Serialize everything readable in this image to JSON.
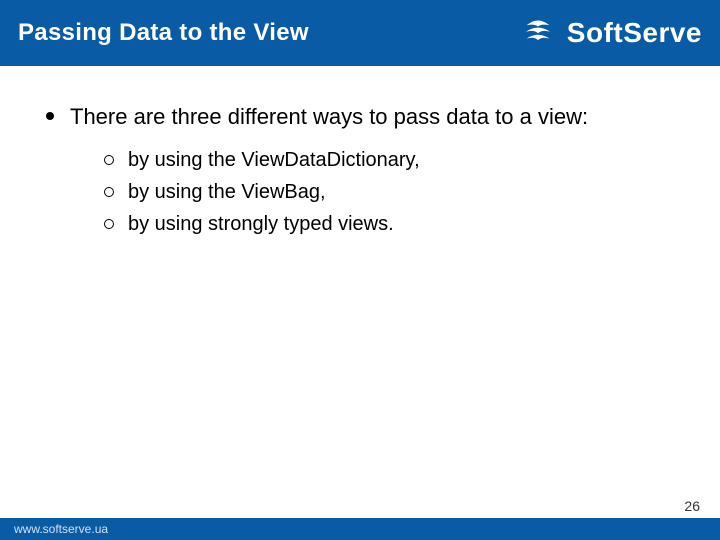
{
  "header": {
    "title": "Passing Data to the View",
    "brand_name": "SoftServe"
  },
  "content": {
    "lead": "There are three different ways to pass data to a view:",
    "items": [
      "by using the ViewDataDictionary,",
      "by using the ViewBag,",
      "by using strongly typed views."
    ]
  },
  "footer": {
    "url": "www.softserve.ua",
    "page_number": "26"
  }
}
